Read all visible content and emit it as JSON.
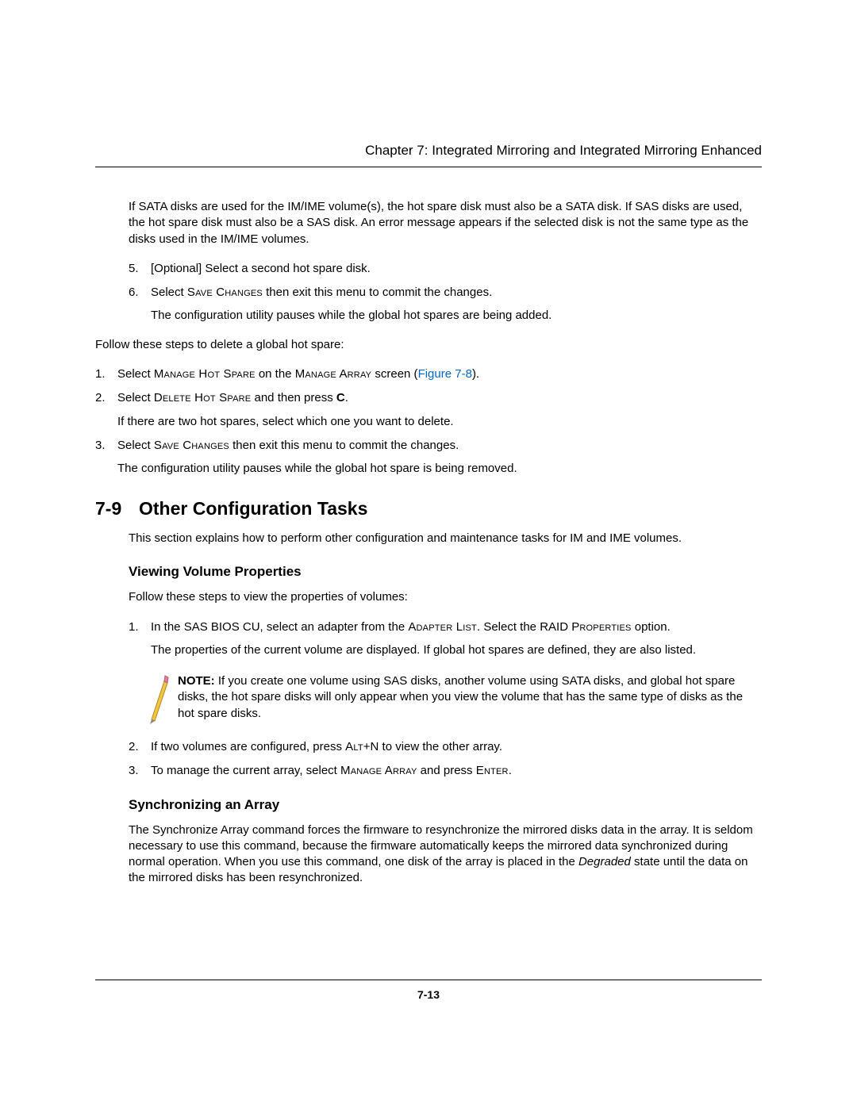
{
  "header": {
    "chapter_line": "Chapter 7: Integrated Mirroring and Integrated Mirroring Enhanced"
  },
  "intro": {
    "sata_para": "If SATA disks are used for the IM/IME volume(s), the hot spare disk must also be a SATA disk. If SAS disks are used, the hot spare disk must also be a SAS disk. An error message appears if the selected disk is not the same type as the disks used in the IM/IME volumes.",
    "list_a": {
      "item5": "[Optional] Select a second hot spare disk.",
      "item6_a": "Select ",
      "item6_sc": "Save Changes",
      "item6_b": " then exit this menu to commit the changes.",
      "item6_after": "The configuration utility pauses while the global hot spares are being added."
    },
    "delete_intro": "Follow these steps to delete a global hot spare:",
    "list_b": {
      "item1_a": "Select ",
      "item1_sc1": "Manage Hot Spare",
      "item1_b": " on the ",
      "item1_sc2": "Manage Array",
      "item1_c": " screen (",
      "item1_link": "Figure 7-8",
      "item1_d": ").",
      "item2_a": "Select ",
      "item2_sc": "Delete Hot Spare",
      "item2_b": " and then press ",
      "item2_bold": "C",
      "item2_c": ".",
      "item2_after": "If there are two hot spares, select which one you want to delete.",
      "item3_a": "Select ",
      "item3_sc": "Save Changes",
      "item3_b": " then exit this menu to commit the changes.",
      "item3_after": "The configuration utility pauses while the global hot spare is being removed."
    }
  },
  "section79": {
    "num": "7-9",
    "title": "Other Configuration Tasks",
    "intro": "This section explains how to perform other configuration and maintenance tasks for IM and IME volumes."
  },
  "viewing": {
    "heading": "Viewing Volume Properties",
    "intro": "Follow these steps to view the properties of volumes:",
    "item1_a": "In the SAS BIOS CU, select an adapter from the ",
    "item1_sc1": "Adapter List",
    "item1_b": ". Select the RAID ",
    "item1_sc2": "Properties",
    "item1_c": " option.",
    "item1_after": "The properties of the current volume are displayed. If global hot spares are defined, they are also listed.",
    "note_label": "NOTE:",
    "note_body": " If you create one volume using SAS disks, another volume using SATA disks, and global hot spare disks, the hot spare disks will only appear when you view the volume that has the same type of disks as the hot spare disks.",
    "item2_a": "If two volumes are configured, press ",
    "item2_sc": "Alt",
    "item2_b": "+N to view the other array.",
    "item3_a": "To manage the current array, select ",
    "item3_sc1": "Manage Array",
    "item3_b": " and press ",
    "item3_sc2": "Enter",
    "item3_c": "."
  },
  "sync": {
    "heading": "Synchronizing an Array",
    "body_a": "The Synchronize Array command forces the firmware to resynchronize the mirrored disks data in the array. It is seldom necessary to use this command, because the firmware automatically keeps the mirrored data synchronized during normal operation. When you use this command, one disk of the array is placed in the ",
    "body_ital": "Degraded",
    "body_b": " state until the data on the mirrored disks has been resynchronized."
  },
  "footer": {
    "page": "7-13"
  }
}
